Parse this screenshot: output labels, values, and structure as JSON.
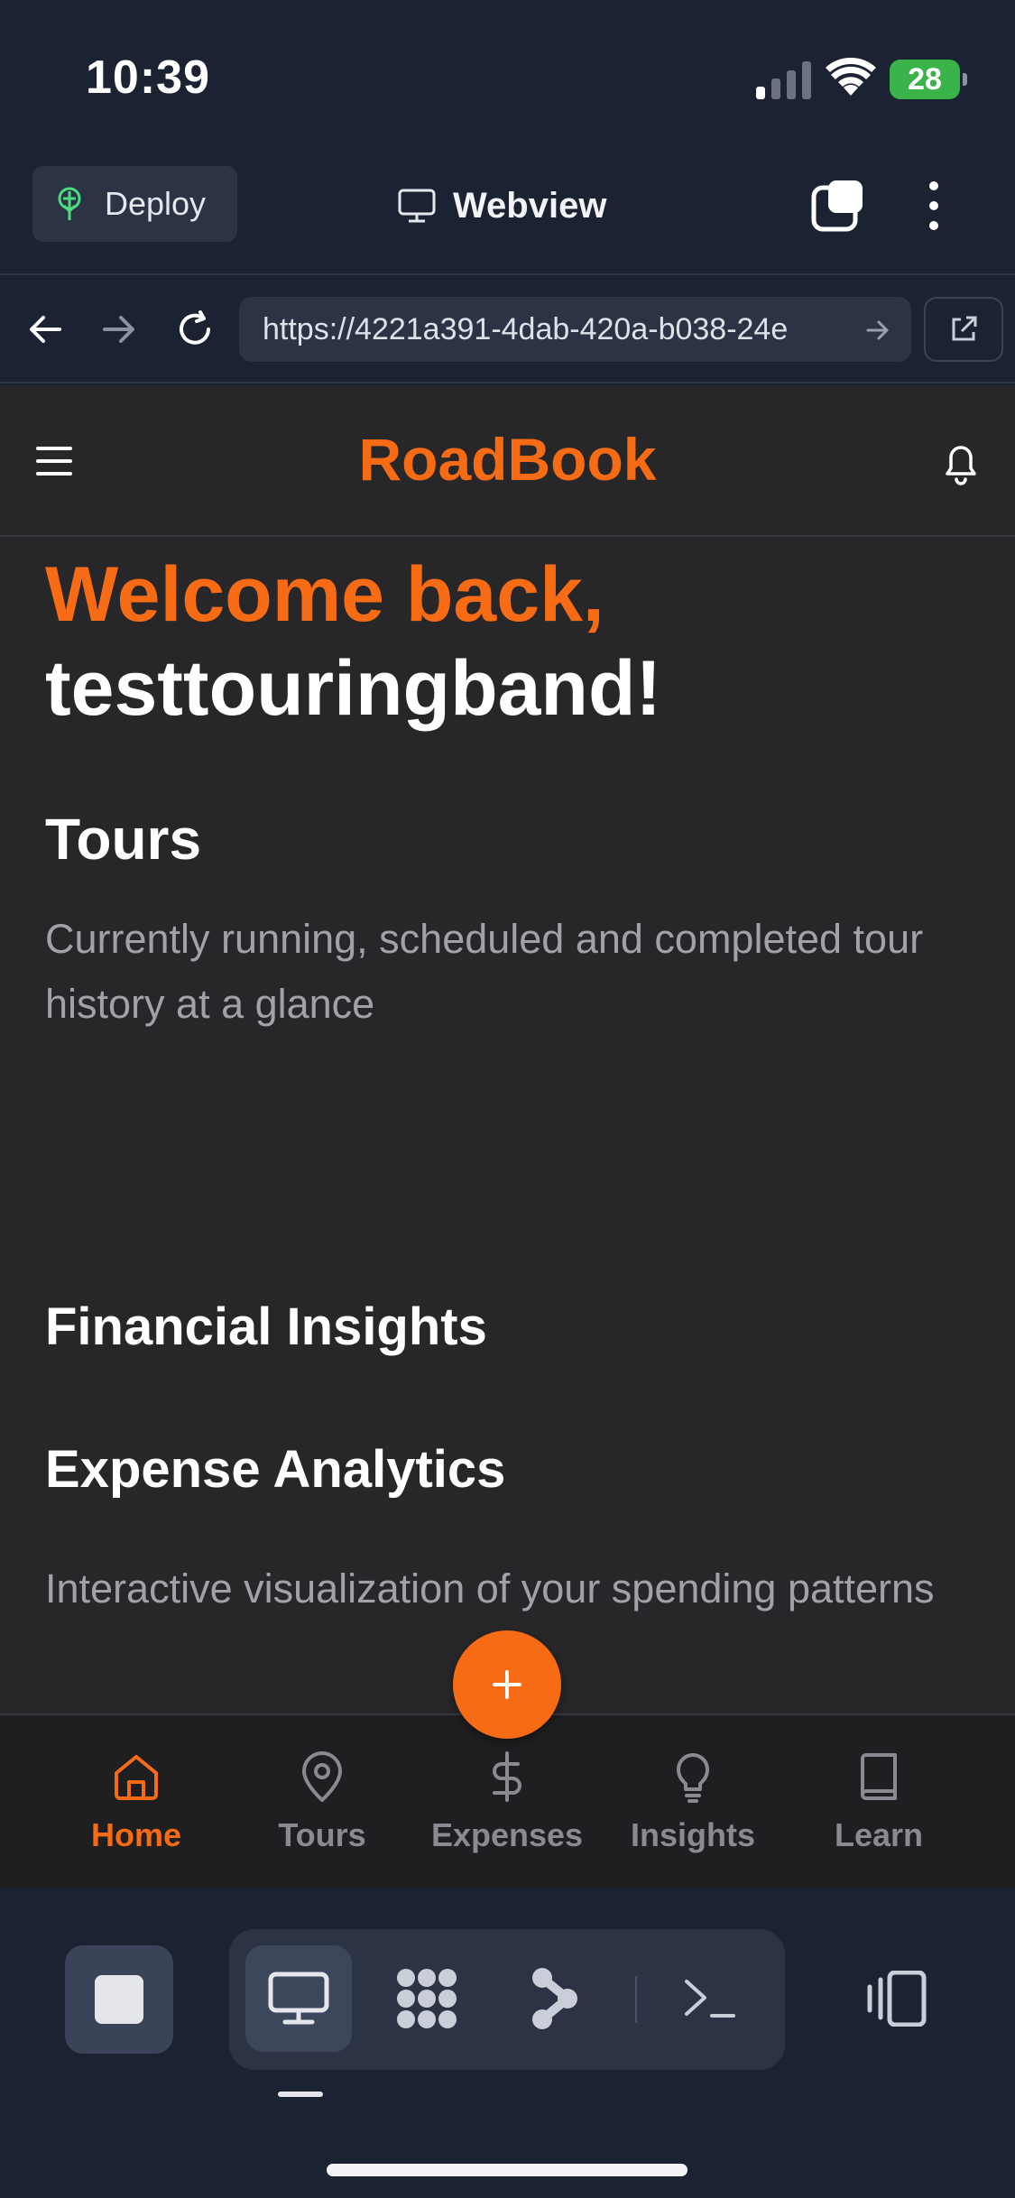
{
  "status_bar": {
    "time": "10:39",
    "battery": "28"
  },
  "toolbar": {
    "deploy_label": "Deploy",
    "webview_label": "Webview"
  },
  "url_bar": {
    "url": "https://4221a391-4dab-420a-b038-24e"
  },
  "app": {
    "brand": "RoadBook",
    "welcome": "Welcome back,",
    "username": "testtouringband!",
    "tours_title": "Tours",
    "tours_subtitle": "Currently running, scheduled and completed tour history at a glance",
    "financial_title": "Financial Insights",
    "expense_title": "Expense Analytics",
    "expense_subtitle": "Interactive visualization of your spending patterns"
  },
  "bottom_nav": {
    "items": [
      {
        "label": "Home",
        "icon": "home-icon",
        "active": true
      },
      {
        "label": "Tours",
        "icon": "map-pin-icon",
        "active": false
      },
      {
        "label": "Expenses",
        "icon": "dollar-icon",
        "active": false
      },
      {
        "label": "Insights",
        "icon": "lightbulb-icon",
        "active": false
      },
      {
        "label": "Learn",
        "icon": "book-icon",
        "active": false
      }
    ]
  },
  "colors": {
    "accent": "#f76b15",
    "app_bg": "#27272a",
    "chrome_bg": "#1b2232"
  }
}
